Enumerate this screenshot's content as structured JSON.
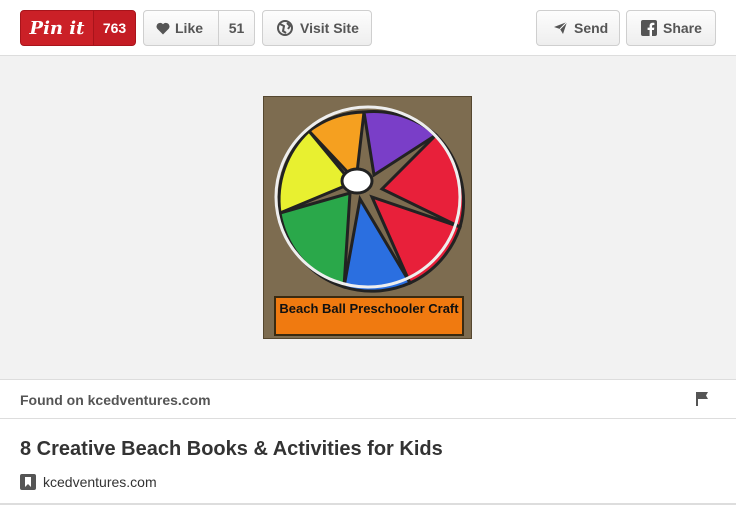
{
  "toolbar": {
    "pin_label": "Pin it",
    "pin_count": "763",
    "like_label": "Like",
    "like_count": "51",
    "visit_label": "Visit Site",
    "send_label": "Send",
    "share_label": "Share"
  },
  "pin": {
    "image_caption": "Beach Ball Preschooler Craft"
  },
  "found_on": {
    "text": "Found on kcedventures.com"
  },
  "article": {
    "title": "8 Creative Beach Books & Activities for Kids",
    "source": "kcedventures.com"
  },
  "colors": {
    "pinterest_red": "#cb2027",
    "stage_bg": "#f2f2f2"
  }
}
